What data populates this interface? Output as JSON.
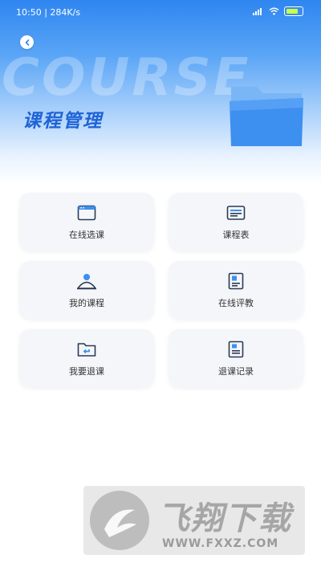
{
  "status_bar": {
    "time": "10:50 | 284K/s",
    "battery_level": 0.85,
    "battery_color": "#c9ff4a"
  },
  "header": {
    "watermark": "COURSE",
    "title": "课程管理",
    "back_icon": "chevron-left-icon",
    "illustration": "folder-icon"
  },
  "menu": [
    {
      "label": "在线选课",
      "icon": "browser-window-icon"
    },
    {
      "label": "课程表",
      "icon": "timetable-icon"
    },
    {
      "label": "我的课程",
      "icon": "user-profile-icon"
    },
    {
      "label": "在线评教",
      "icon": "evaluation-document-icon"
    },
    {
      "label": "我要退课",
      "icon": "folder-return-icon"
    },
    {
      "label": "退课记录",
      "icon": "record-document-icon"
    }
  ],
  "ad": {
    "title": "飞翔下载",
    "url": "WWW.FXXZ.COM"
  },
  "colors": {
    "accent": "#2f86f0",
    "title": "#1f63d6",
    "icon": "#2b3a55",
    "card_bg": "#f4f6f9"
  }
}
